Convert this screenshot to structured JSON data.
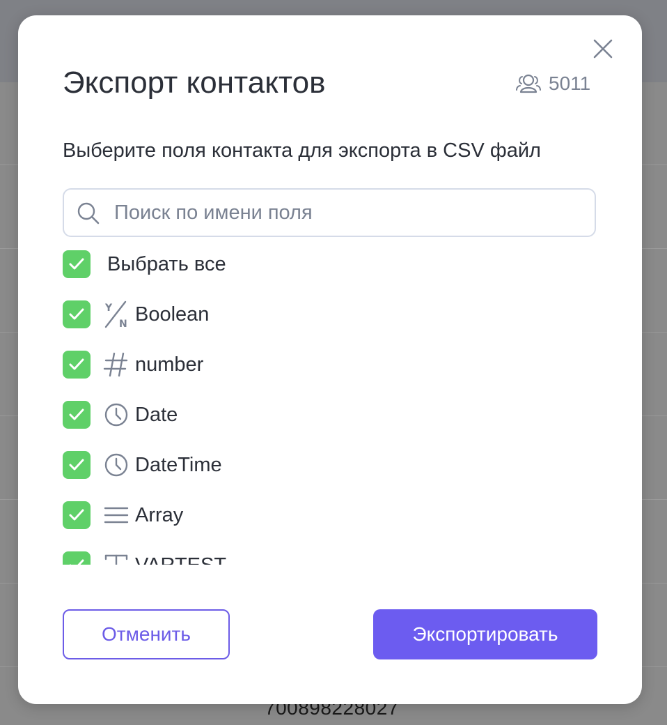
{
  "background": {
    "number_text": "700898228027"
  },
  "modal": {
    "title": "Экспорт контактов",
    "contacts_count": "5011",
    "subtitle": "Выберите поля контакта для экспорта в CSV файл",
    "search": {
      "placeholder": "Поиск по имени поля",
      "value": ""
    },
    "select_all": {
      "label": "Выбрать все",
      "checked": true
    },
    "fields": [
      {
        "label": "Boolean",
        "icon": "yes-no-icon",
        "checked": true
      },
      {
        "label": "number",
        "icon": "hash-icon",
        "checked": true
      },
      {
        "label": "Date",
        "icon": "clock-icon",
        "checked": true
      },
      {
        "label": "DateTime",
        "icon": "clock-icon",
        "checked": true
      },
      {
        "label": "Array",
        "icon": "list-lines-icon",
        "checked": true
      },
      {
        "label": "VARTEST",
        "icon": "text-icon",
        "checked": true
      }
    ],
    "buttons": {
      "cancel_label": "Отменить",
      "export_label": "Экспортировать"
    }
  },
  "colors": {
    "accent": "#6c5cf0",
    "checkbox": "#5fd068",
    "text": "#2b2f38",
    "muted": "#7a8292"
  }
}
